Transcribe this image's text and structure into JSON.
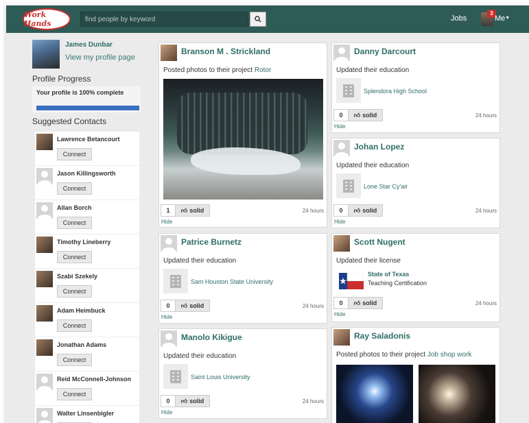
{
  "header": {
    "logo_text": "Work Hands",
    "search_placeholder": "find people by keyword",
    "jobs_label": "Jobs",
    "me_label": "Me",
    "notification_count": "3"
  },
  "profile": {
    "name": "James Dunbar",
    "view_link": "View my profile page"
  },
  "progress": {
    "title": "Profile Progress",
    "text": "Your profile is 100% complete",
    "percent": 100
  },
  "contacts": {
    "title": "Suggested Contacts",
    "connect_label": "Connect",
    "items": [
      {
        "name": "Lawrence Betancourt",
        "photo": true
      },
      {
        "name": "Jason Killingsworth",
        "photo": false
      },
      {
        "name": "Allan Borch",
        "photo": false
      },
      {
        "name": "Timothy Lineberry",
        "photo": true
      },
      {
        "name": "Szabi Szekely",
        "photo": true
      },
      {
        "name": "Adam Heimbuck",
        "photo": true
      },
      {
        "name": "Jonathan Adams",
        "photo": true
      },
      {
        "name": "Reid McConnell-Johnson",
        "photo": false
      },
      {
        "name": "Walter Linsenbigler",
        "photo": false
      }
    ]
  },
  "feed": {
    "solid_label": "solid",
    "hide_label": "Hide",
    "cards": [
      {
        "name": "Branson M . Strickland",
        "action": "Posted photos to their project ",
        "link": "Rotor",
        "count": "1",
        "time": "24 hours"
      },
      {
        "name": "Danny Darcourt",
        "action": "Updated their education",
        "entity": "Splendora High School",
        "count": "0",
        "time": "24 hours"
      },
      {
        "name": "Johan Lopez",
        "action": "Updated their education",
        "entity": "Lone Star Cy'air",
        "count": "0",
        "time": "24 hours"
      },
      {
        "name": "Patrice Burnetz",
        "action": "Updated their education",
        "entity": "Sam Houston State University",
        "count": "0",
        "time": "24 hours"
      },
      {
        "name": "Scott Nugent",
        "action": "Updated their license",
        "license_title": "State of Texas",
        "license_sub": "Teaching Certification",
        "count": "0",
        "time": "24 hours"
      },
      {
        "name": "Manolo Kikigue",
        "action": "Updated their education",
        "entity": "Saint Louis University",
        "count": "0",
        "time": "24 hours"
      },
      {
        "name": "Ray Saladonis",
        "action": "Posted photos to their project ",
        "link": "Job shop work"
      }
    ]
  },
  "colors": {
    "topbar": "#2f5b57",
    "accent": "#2f6e68",
    "logo_red": "#c8312f",
    "progress": "#3b6fbf"
  }
}
